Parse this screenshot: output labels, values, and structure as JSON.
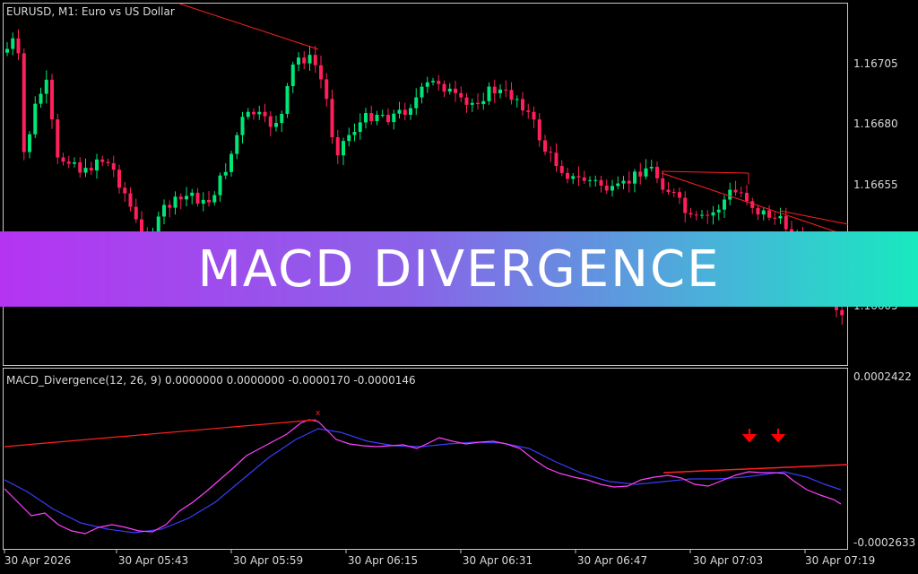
{
  "main_chart": {
    "title": "EURUSD, M1:  Euro vs US Dollar",
    "price_labels": [
      "1.16705",
      "1.16680",
      "1.16655",
      "1.16605"
    ],
    "colors": {
      "bull": "#00e676",
      "bear": "#ff1f5a",
      "trendline": "#ff2020",
      "frame": "#c8c8c8"
    }
  },
  "indicator": {
    "title": "MACD_Divergence(12, 26, 9) 0.0000000 0.0000000 -0.0000170 -0.0000146",
    "scale_top": "0.0002422",
    "scale_bottom": "-0.0002633",
    "colors": {
      "macd": "#ff40ff",
      "signal": "#3b3bff",
      "divergence": "#ff2020",
      "arrow": "#ff0000"
    }
  },
  "time_axis": [
    "30 Apr 2026",
    "30 Apr 05:43",
    "30 Apr 05:59",
    "30 Apr 06:15",
    "30 Apr 06:31",
    "30 Apr 06:47",
    "30 Apr 07:03",
    "30 Apr 07:19"
  ],
  "banner": {
    "text": "MACD DIVERGENCE"
  }
}
